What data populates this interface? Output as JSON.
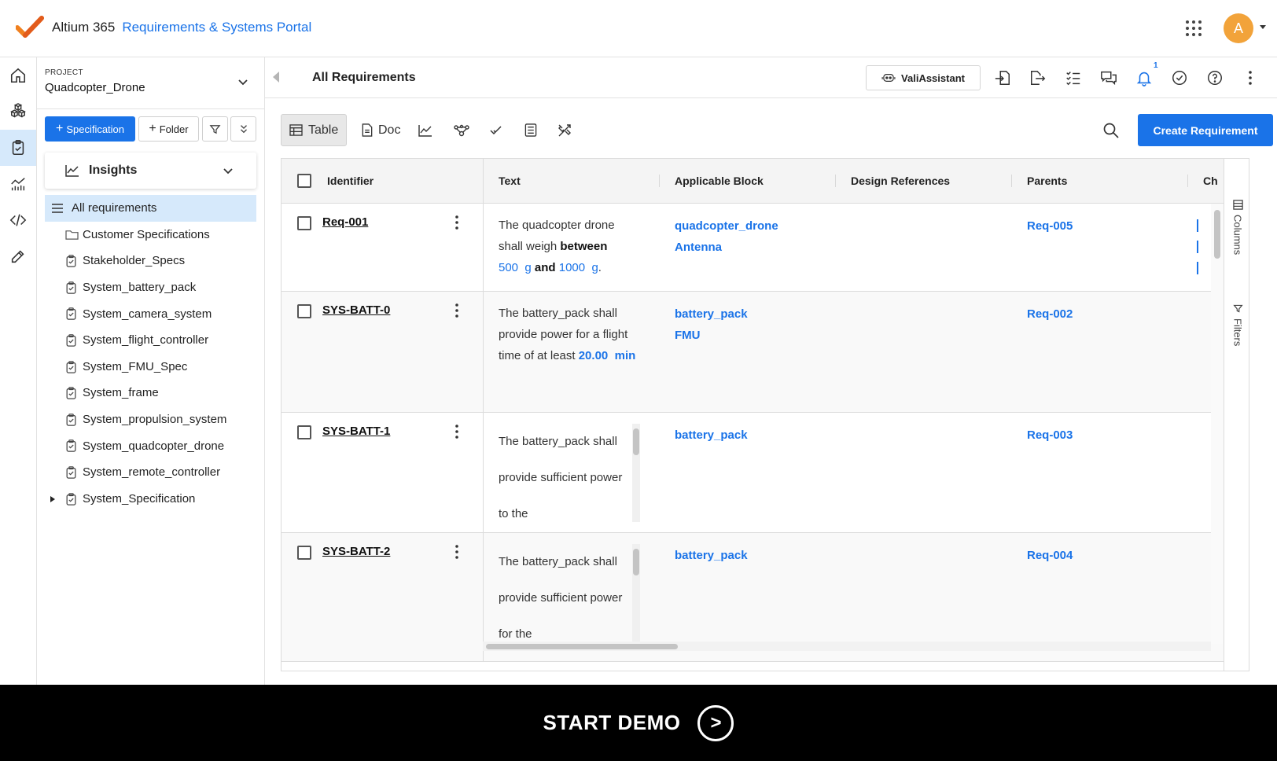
{
  "app": {
    "brand": "Altium 365",
    "portal": "Requirements & Systems Portal",
    "avatar_initial": "A",
    "accent": "#1a73e8",
    "avatar_color": "#f2a33a"
  },
  "rail": {
    "icons": [
      "home-icon",
      "blocks-icon",
      "requirements-icon",
      "analytics-icon",
      "code-icon",
      "tools-icon"
    ]
  },
  "sidebar": {
    "project_label": "PROJECT",
    "project_name": "Quadcopter_Drone",
    "spec_button": "Specification",
    "folder_button": "Folder",
    "insights_label": "Insights",
    "tree": [
      {
        "label": "All requirements",
        "icon": "list-icon"
      },
      {
        "label": "Customer Specifications",
        "icon": "folder-icon"
      },
      {
        "label": "Stakeholder_Specs",
        "icon": "clipboard-icon"
      },
      {
        "label": "System_battery_pack",
        "icon": "clipboard-icon"
      },
      {
        "label": "System_camera_system",
        "icon": "clipboard-icon"
      },
      {
        "label": "System_flight_controller",
        "icon": "clipboard-icon"
      },
      {
        "label": "System_FMU_Spec",
        "icon": "clipboard-icon"
      },
      {
        "label": "System_frame",
        "icon": "clipboard-icon"
      },
      {
        "label": "System_propulsion_system",
        "icon": "clipboard-icon"
      },
      {
        "label": "System_quadcopter_drone",
        "icon": "clipboard-icon"
      },
      {
        "label": "System_remote_controller",
        "icon": "clipboard-icon"
      },
      {
        "label": "System_Specification",
        "icon": "clipboard-icon"
      }
    ]
  },
  "header": {
    "title": "All Requirements",
    "assistant_label": "ValiAssistant",
    "notification_count": "1"
  },
  "toolbar": {
    "table_label": "Table",
    "doc_label": "Doc",
    "create_label": "Create Requirement"
  },
  "table": {
    "columns": [
      "Identifier",
      "Text",
      "Applicable Block",
      "Design References",
      "Parents",
      "Ch"
    ],
    "rows": [
      {
        "id": "Req-001",
        "text": {
          "line1": "The quadcopter drone",
          "line2a": "shall weigh ",
          "line2b": "between",
          "v1": "500",
          "u1": "g",
          "and": "and",
          "v2": "1000",
          "u2": "g",
          "end": "."
        },
        "blocks": [
          "quadcopter_drone",
          "Antenna"
        ],
        "parent": "Req-005"
      },
      {
        "id": "SYS-BATT-0",
        "text": {
          "line1": "The battery_pack shall",
          "line2": "provide power for a flight",
          "line3": "time of at least ",
          "v": "20.00",
          "u": "min"
        },
        "blocks": [
          "battery_pack",
          "FMU"
        ],
        "parent": "Req-002"
      },
      {
        "id": "SYS-BATT-1",
        "text": {
          "line1": "The battery_pack shall",
          "line2": "provide sufficient power",
          "line3": "to the"
        },
        "blocks": [
          "battery_pack"
        ],
        "parent": "Req-003"
      },
      {
        "id": "SYS-BATT-2",
        "text": {
          "line1": "The battery_pack shall",
          "line2": "provide sufficient power",
          "line3": "for the"
        },
        "blocks": [
          "battery_pack"
        ],
        "parent": "Req-004"
      }
    ]
  },
  "side_panel": {
    "columns_label": "Columns",
    "filters_label": "Filters"
  },
  "demo": {
    "label": "START DEMO",
    "play_symbol": ">"
  }
}
